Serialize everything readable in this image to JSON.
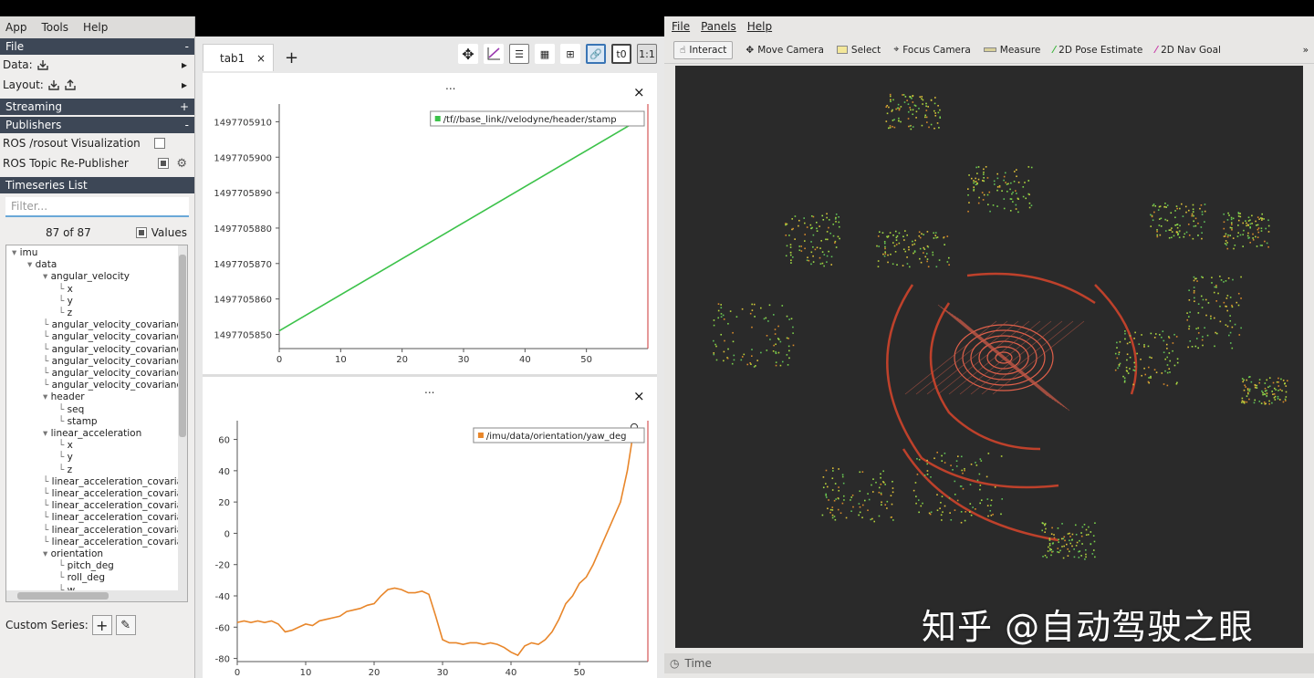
{
  "pj_menu": {
    "app": "App",
    "tools": "Tools",
    "help": "Help"
  },
  "sections": {
    "file": "File",
    "streaming": "Streaming",
    "publishers": "Publishers",
    "timeseries": "Timeseries List"
  },
  "file_rows": {
    "data": "Data:",
    "layout": "Layout:"
  },
  "publishers": [
    {
      "label": "ROS /rosout Visualization",
      "checked": false
    },
    {
      "label": "ROS Topic Re-Publisher",
      "checked": true
    }
  ],
  "filter_placeholder": "Filter...",
  "series_count": "87 of 87",
  "values_label": "Values",
  "tree": [
    {
      "label": "imu",
      "depth": 0
    },
    {
      "label": "data",
      "depth": 1
    },
    {
      "label": "angular_velocity",
      "depth": 2
    },
    {
      "label": "x",
      "depth": 3
    },
    {
      "label": "y",
      "depth": 3
    },
    {
      "label": "z",
      "depth": 3
    },
    {
      "label": "angular_velocity_covarianc",
      "depth": 2
    },
    {
      "label": "angular_velocity_covarianc",
      "depth": 2
    },
    {
      "label": "angular_velocity_covarianc",
      "depth": 2
    },
    {
      "label": "angular_velocity_covarianc",
      "depth": 2
    },
    {
      "label": "angular_velocity_covarianc",
      "depth": 2
    },
    {
      "label": "angular_velocity_covarianc",
      "depth": 2
    },
    {
      "label": "header",
      "depth": 2
    },
    {
      "label": "seq",
      "depth": 3
    },
    {
      "label": "stamp",
      "depth": 3
    },
    {
      "label": "linear_acceleration",
      "depth": 2
    },
    {
      "label": "x",
      "depth": 3
    },
    {
      "label": "y",
      "depth": 3
    },
    {
      "label": "z",
      "depth": 3
    },
    {
      "label": "linear_acceleration_covaria",
      "depth": 2
    },
    {
      "label": "linear_acceleration_covaria",
      "depth": 2
    },
    {
      "label": "linear_acceleration_covaria",
      "depth": 2
    },
    {
      "label": "linear_acceleration_covaria",
      "depth": 2
    },
    {
      "label": "linear_acceleration_covaria",
      "depth": 2
    },
    {
      "label": "linear_acceleration_covaria",
      "depth": 2
    },
    {
      "label": "orientation",
      "depth": 2
    },
    {
      "label": "pitch_deg",
      "depth": 3
    },
    {
      "label": "roll_deg",
      "depth": 3
    },
    {
      "label": "w",
      "depth": 3
    }
  ],
  "custom_series": "Custom Series:",
  "tab": {
    "label": "tab1",
    "close": "×",
    "add": "+"
  },
  "toolbar_text": {
    "t0": "t0",
    "ratio": "1:1"
  },
  "plot_dots": "...",
  "plot_close": "×",
  "chart_data": [
    {
      "type": "line",
      "series": [
        {
          "name": "/tf//base_link//velodyne/header/stamp",
          "color": "#3cc24a",
          "x": [
            0,
            58
          ],
          "values": [
            1497705851,
            1497705910
          ]
        }
      ],
      "xlim": [
        0,
        60
      ],
      "ylim": [
        1497705846,
        1497705915
      ],
      "xticks": [
        0,
        10,
        20,
        30,
        40,
        50
      ],
      "yticks": [
        1497705850,
        1497705860,
        1497705870,
        1497705880,
        1497705890,
        1497705900,
        1497705910
      ]
    },
    {
      "type": "line",
      "series": [
        {
          "name": "/imu/data/orientation/yaw_deg",
          "color": "#e8862a",
          "x": [
            0,
            1,
            2,
            3,
            4,
            5,
            6,
            7,
            8,
            9,
            10,
            11,
            12,
            13,
            14,
            15,
            16,
            17,
            18,
            19,
            20,
            21,
            22,
            23,
            24,
            25,
            26,
            27,
            28,
            29,
            30,
            31,
            32,
            33,
            34,
            35,
            36,
            37,
            38,
            39,
            40,
            41,
            42,
            43,
            44,
            45,
            46,
            47,
            48,
            49,
            50,
            51,
            52,
            53,
            54,
            55,
            56,
            57,
            58
          ],
          "values": [
            -57,
            -56,
            -57,
            -56,
            -57,
            -56,
            -58,
            -63,
            -62,
            -60,
            -58,
            -59,
            -56,
            -55,
            -54,
            -53,
            -50,
            -49,
            -48,
            -46,
            -45,
            -40,
            -36,
            -35,
            -36,
            -38,
            -38,
            -37,
            -39,
            -53,
            -68,
            -70,
            -70,
            -71,
            -70,
            -70,
            -71,
            -70,
            -71,
            -73,
            -76,
            -78,
            -72,
            -70,
            -71,
            -68,
            -63,
            -55,
            -45,
            -40,
            -32,
            -28,
            -20,
            -10,
            0,
            10,
            20,
            40,
            68
          ]
        }
      ],
      "xlim": [
        0,
        60
      ],
      "ylim": [
        -82,
        72
      ],
      "xticks": [
        0,
        10,
        20,
        30,
        40,
        50
      ],
      "yticks": [
        -80,
        -60,
        -40,
        -20,
        0,
        20,
        40,
        60
      ]
    }
  ],
  "rviz_menu": {
    "file": "File",
    "panels": "Panels",
    "help": "Help"
  },
  "rviz_tools": [
    "Interact",
    "Move Camera",
    "Select",
    "Focus Camera",
    "Measure",
    "2D Pose Estimate",
    "2D Nav Goal"
  ],
  "rviz_time": "Time",
  "watermark": "知乎 @自动驾驶之眼"
}
